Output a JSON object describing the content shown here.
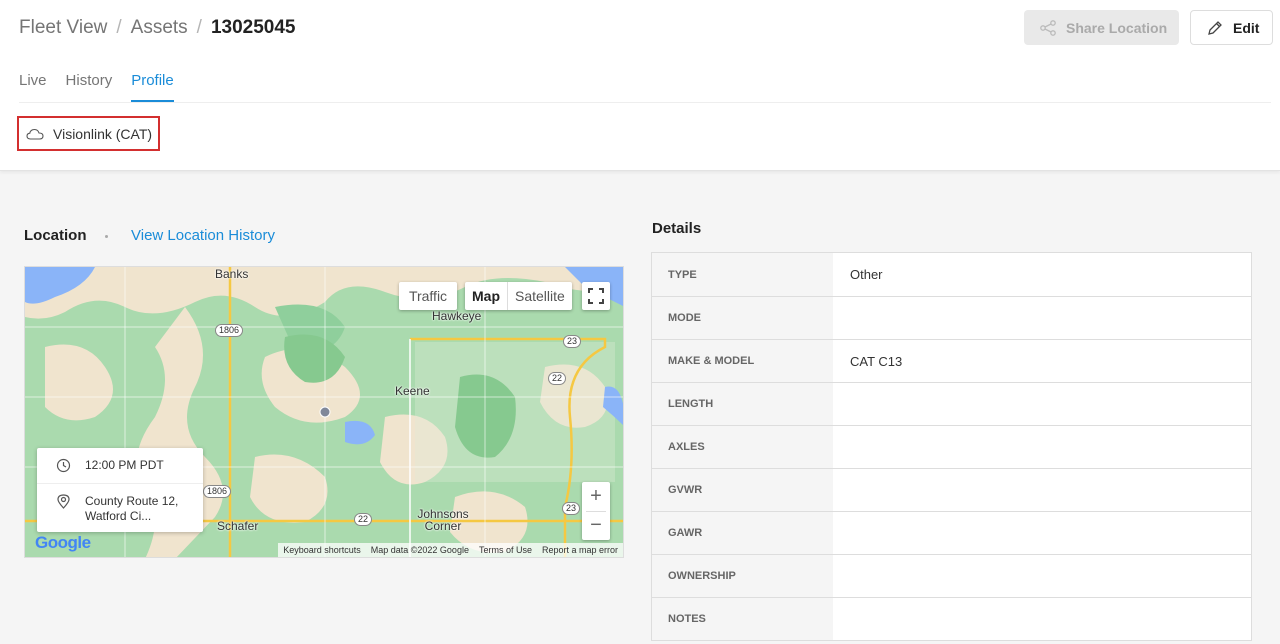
{
  "breadcrumb": {
    "items": [
      "Fleet View",
      "Assets"
    ],
    "current": "13025045",
    "separator": "/"
  },
  "actions": {
    "share_label": "Share Location",
    "edit_label": "Edit"
  },
  "tabs": [
    {
      "label": "Live",
      "active": false
    },
    {
      "label": "History",
      "active": false
    },
    {
      "label": "Profile",
      "active": true
    }
  ],
  "source": {
    "label": "Visionlink (CAT)",
    "icon": "cloud-icon"
  },
  "location": {
    "title": "Location",
    "history_link": "View Location History",
    "map": {
      "controls": {
        "traffic": "Traffic",
        "map": "Map",
        "satellite": "Satellite",
        "zoom_in": "+",
        "zoom_out": "−"
      },
      "places": [
        "Banks",
        "Hawkeye",
        "Keene",
        "Johnsons Corner",
        "Schafer"
      ],
      "roads": [
        "1806",
        "23",
        "22",
        "1806",
        "23",
        "22",
        "23"
      ],
      "info": {
        "time": "12:00 PM PDT",
        "address_line1": "County Route 12,",
        "address_line2": "Watford Ci..."
      },
      "footer": [
        "Keyboard shortcuts",
        "Map data ©2022 Google",
        "Terms of Use",
        "Report a map error"
      ],
      "logo": "Google"
    }
  },
  "details": {
    "title": "Details",
    "rows": [
      {
        "key": "TYPE",
        "value": "Other"
      },
      {
        "key": "MODE",
        "value": ""
      },
      {
        "key": "MAKE & MODEL",
        "value": "CAT C13"
      },
      {
        "key": "LENGTH",
        "value": ""
      },
      {
        "key": "AXLES",
        "value": ""
      },
      {
        "key": "GVWR",
        "value": ""
      },
      {
        "key": "GAWR",
        "value": ""
      },
      {
        "key": "OWNERSHIP",
        "value": ""
      },
      {
        "key": "NOTES",
        "value": ""
      }
    ]
  },
  "colors": {
    "accent": "#1a8cd8",
    "highlight_border": "#d32f2f"
  }
}
